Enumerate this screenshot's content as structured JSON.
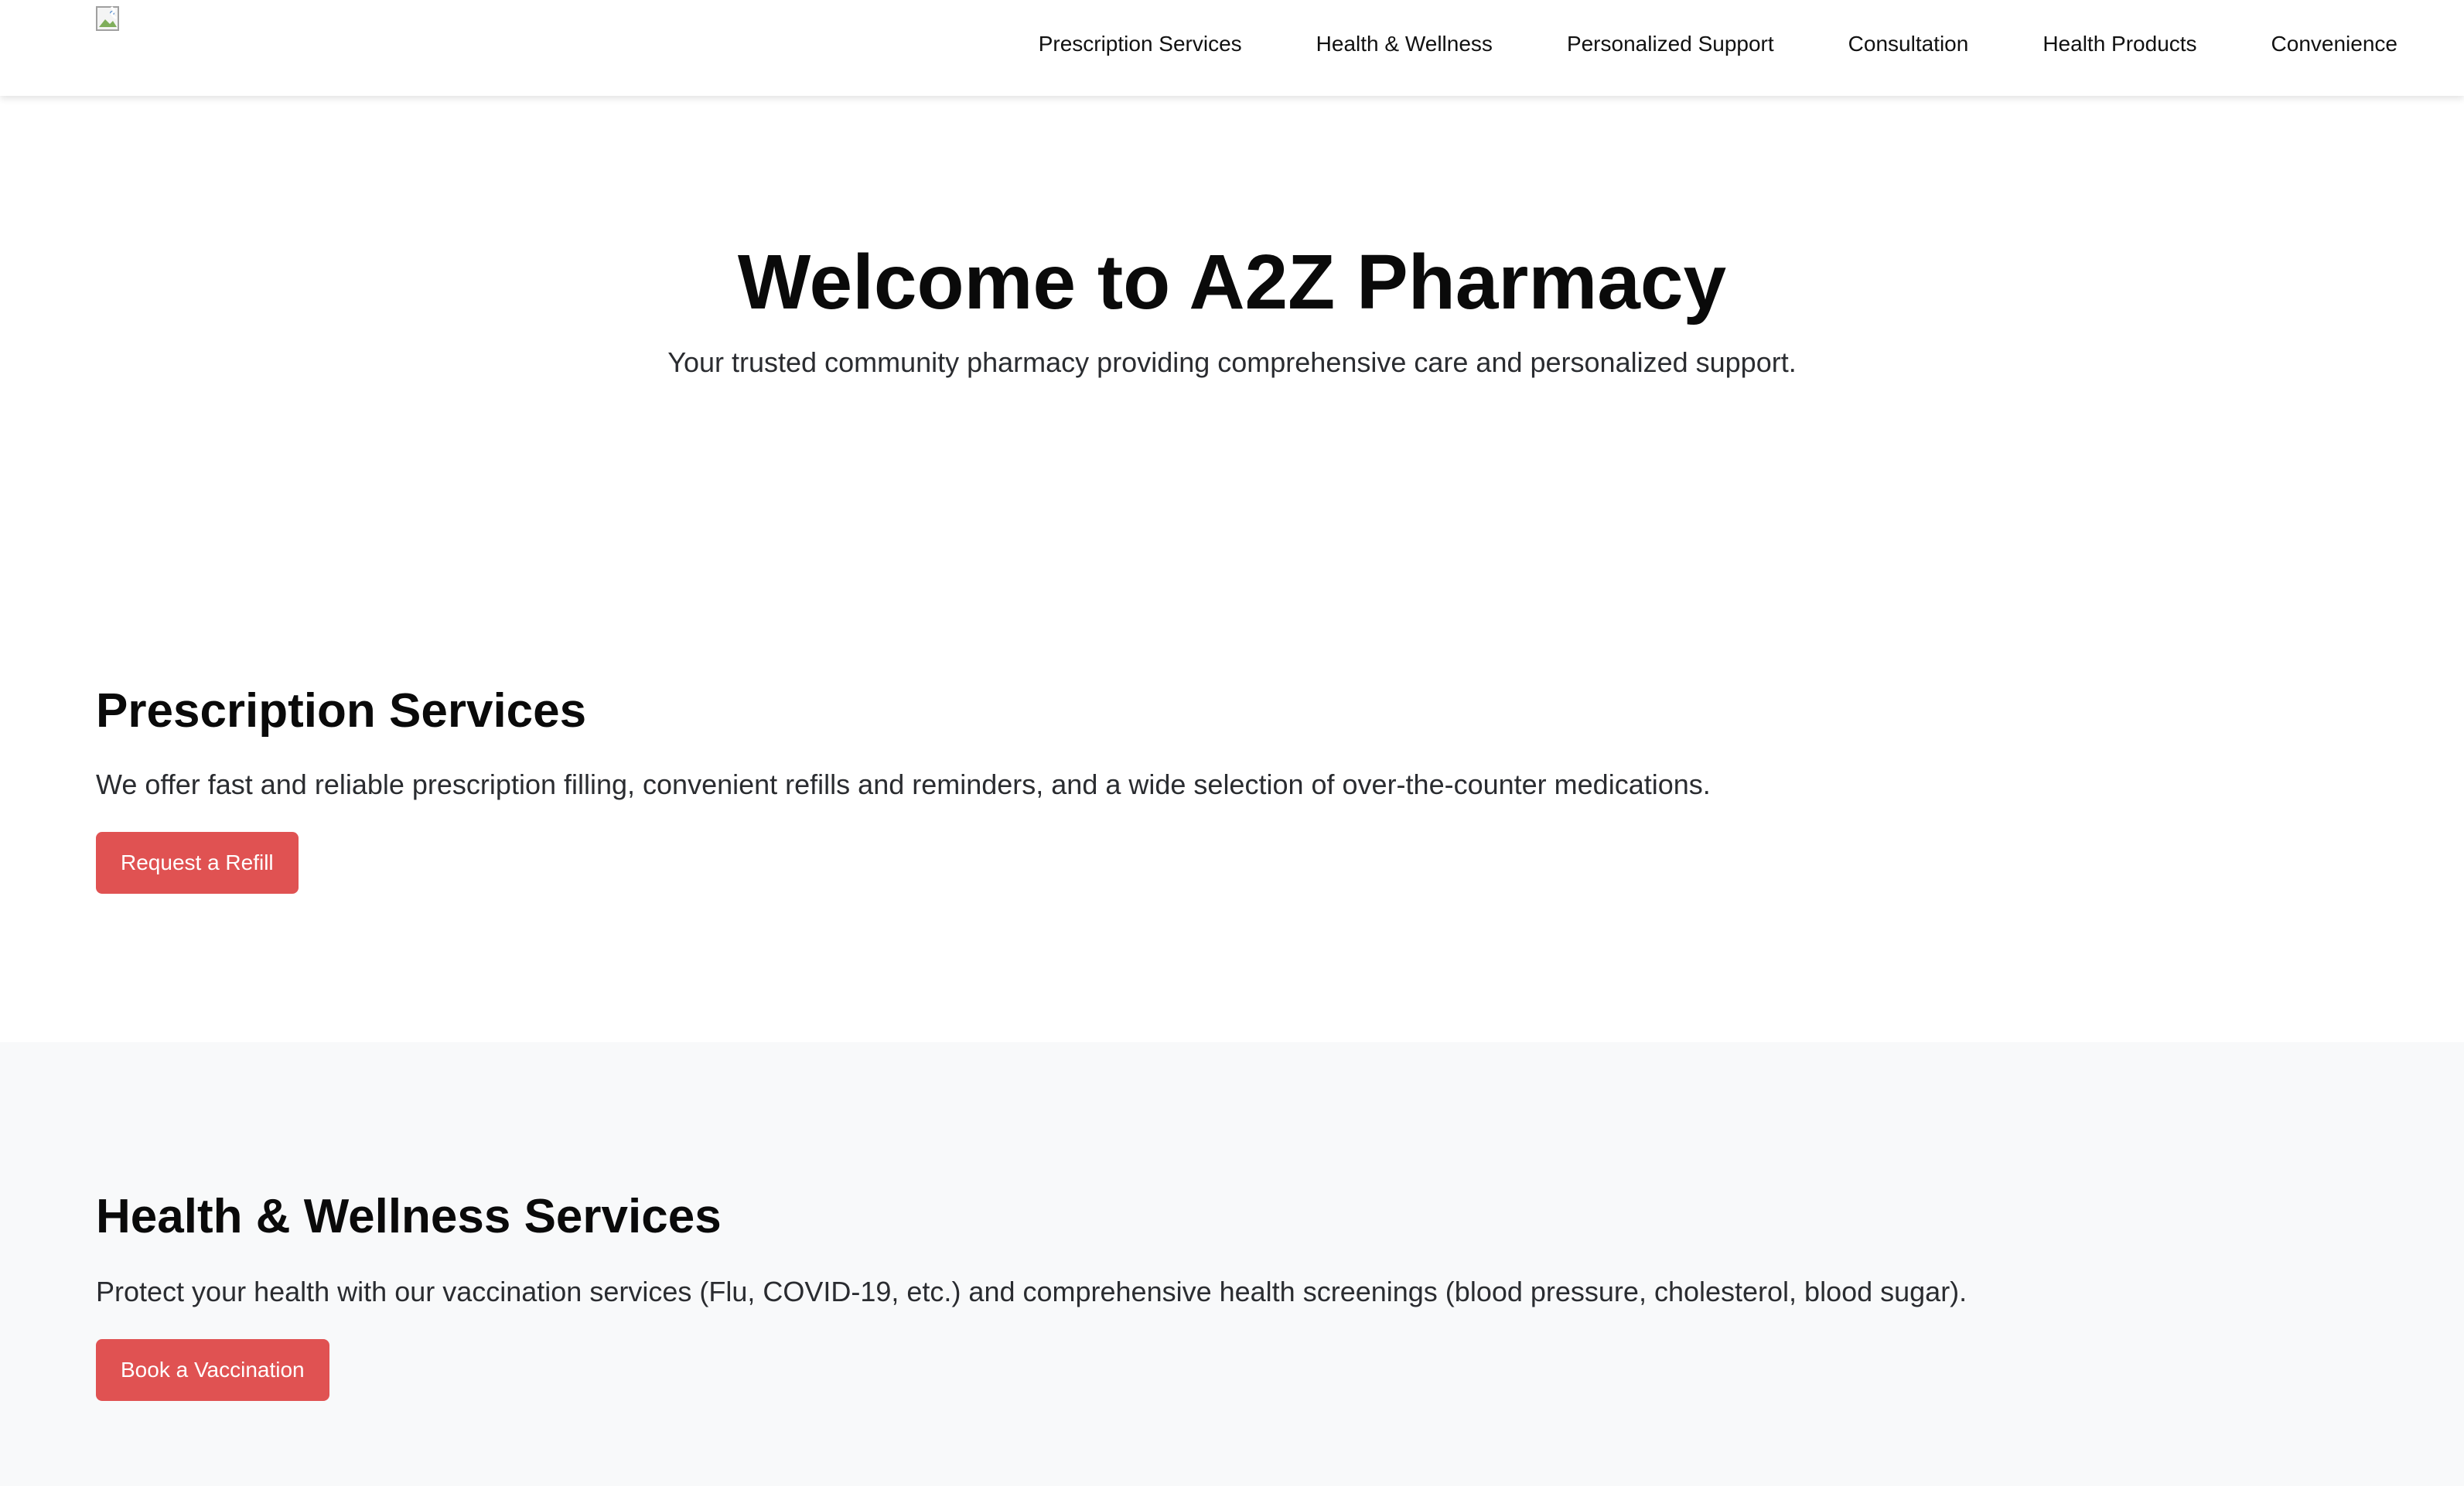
{
  "header": {
    "logo_icon": "broken-image-icon",
    "nav_items": [
      {
        "label": "Prescription Services"
      },
      {
        "label": "Health & Wellness"
      },
      {
        "label": "Personalized Support"
      },
      {
        "label": "Consultation"
      },
      {
        "label": "Health Products"
      },
      {
        "label": "Convenience"
      }
    ]
  },
  "hero": {
    "title": "Welcome to A2Z Pharmacy",
    "subtitle": "Your trusted community pharmacy providing comprehensive care and personalized support."
  },
  "sections": {
    "prescription": {
      "heading": "Prescription Services",
      "body": "We offer fast and reliable prescription filling, convenient refills and reminders, and a wide selection of over-the-counter medications.",
      "button_label": "Request a Refill"
    },
    "wellness": {
      "heading": "Health & Wellness Services",
      "body": "Protect your health with our vaccination services (Flu, COVID-19, etc.) and comprehensive health screenings (blood pressure, cholesterol, blood sugar).",
      "button_label": "Book a Vaccination"
    }
  },
  "colors": {
    "accent_button": "#e05252",
    "alt_section_background": "#f8f9fa",
    "header_background": "#ffffff"
  }
}
